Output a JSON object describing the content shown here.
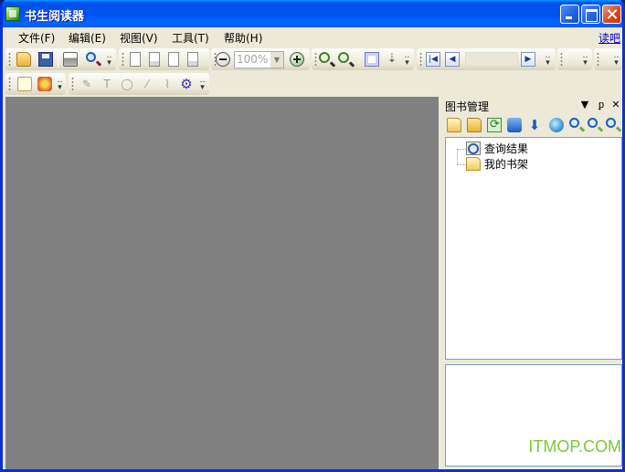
{
  "window": {
    "title": "书生阅读器"
  },
  "menu": {
    "items": [
      "文件(F)",
      "编辑(E)",
      "视图(V)",
      "工具(T)",
      "帮助(H)"
    ],
    "right_link": "读吧"
  },
  "toolbar": {
    "zoom_value": "100%",
    "icons_row1": [
      "open-folder-icon",
      "save-icon",
      "print-icon",
      "find-icon",
      "single-page-icon",
      "facing-pages-icon",
      "continuous-page-icon",
      "multi-page-icon",
      "zoom-out-circle-icon",
      "zoom-in-circle-icon",
      "magnify-plus-icon",
      "magnify-minus-icon",
      "fit-page-icon",
      "scroll-down-icon",
      "first-page-icon",
      "previous-page-icon",
      "next-page-icon"
    ],
    "icons_row2": [
      "note-icon",
      "stamp-icon",
      "pen-icon",
      "text-tool-icon",
      "ellipse-tool-icon",
      "line-tool-icon",
      "settings-gear-icon"
    ]
  },
  "panel": {
    "title": "图书管理",
    "title_controls": [
      "dropdown-arrow-icon",
      "pin-icon",
      "close-icon"
    ],
    "tools": [
      "new-folder-icon",
      "open-folder-icon",
      "refresh-icon",
      "upload-icon",
      "download-icon",
      "network-icon",
      "search-icon",
      "search-next-icon",
      "search-web-icon"
    ],
    "tree": [
      {
        "label": "查询结果",
        "icon": "search-results-icon"
      },
      {
        "label": "我的书架",
        "icon": "folder-icon"
      }
    ]
  },
  "watermark": "ITMOP.COM",
  "colors": {
    "title_bar": "#0050ee",
    "canvas": "#808080",
    "chrome": "#ece9d8",
    "link": "#0000cc",
    "watermark": "#7dc834"
  }
}
